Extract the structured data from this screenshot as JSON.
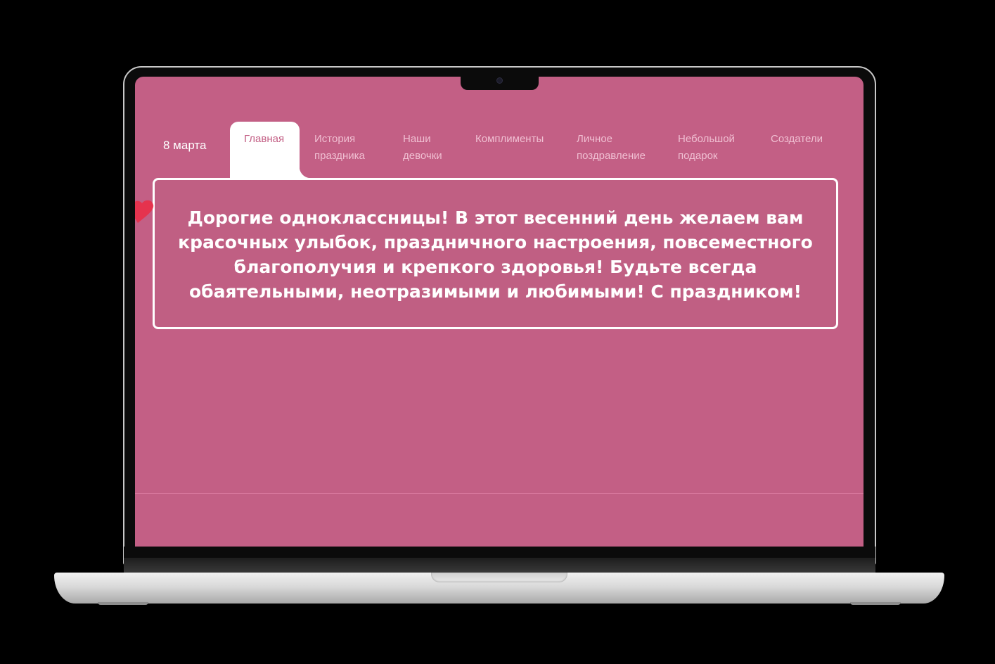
{
  "site": {
    "brand": "8 марта",
    "nav": [
      {
        "label": "Главная",
        "active": true
      },
      {
        "label": "История праздника",
        "active": false
      },
      {
        "label": "Наши девочки",
        "active": false
      },
      {
        "label": "Комплименты",
        "active": false
      },
      {
        "label": "Личное поздравление",
        "active": false
      },
      {
        "label": "Небольшой подарок",
        "active": false
      },
      {
        "label": "Создатели",
        "active": false
      }
    ],
    "greeting": "Дорогие одноклассницы! В этот весенний день желаем вам красочных улыбок, праздничного настроения, повсеместного благополучия и крепкого здоровья! Будьте всегда обаятельными, неотразимыми и любимыми! С праздником!"
  },
  "colors": {
    "page_background": "#c35f85",
    "nav_inactive_text": "#f0bfd2",
    "active_tab_background": "#ffffff",
    "heart": "#e8304a"
  },
  "icons": {
    "heart": "heart-icon",
    "camera": "camera-icon"
  }
}
